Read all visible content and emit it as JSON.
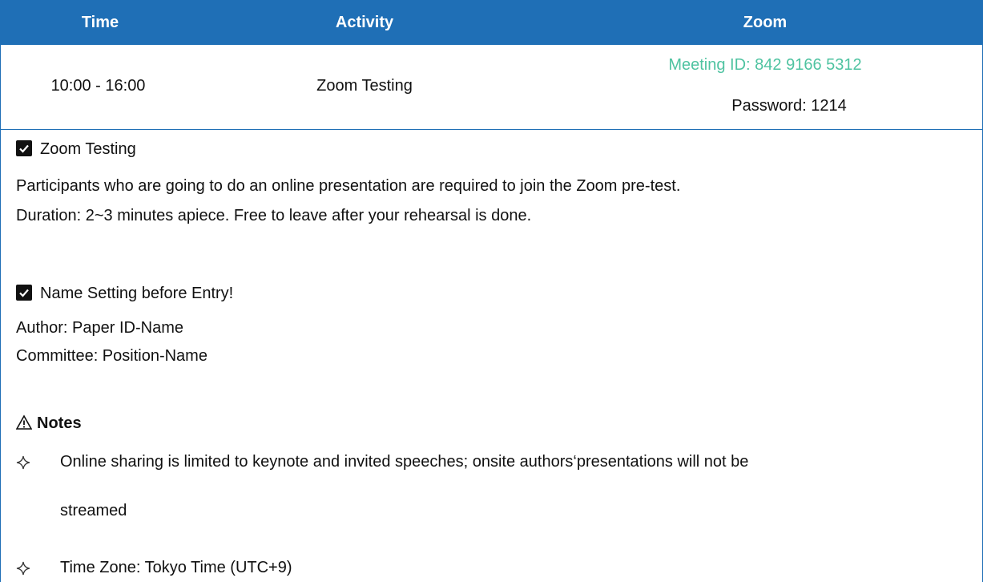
{
  "table": {
    "headers": [
      "Time",
      "Activity",
      "Zoom"
    ],
    "row": {
      "time": "10:00 - 16:00",
      "activity": "Zoom Testing",
      "meeting_id": "Meeting ID: 842 9166 5312",
      "password": "Password: 1214"
    }
  },
  "zoom_testing": {
    "title": "Zoom Testing",
    "line1": "Participants who are going to do an online presentation are required to join the Zoom pre-test.",
    "line2": "Duration: 2~3 minutes apiece. Free to leave after your rehearsal is done."
  },
  "name_setting": {
    "title": "Name Setting before Entry!",
    "author": "Author: Paper ID-Name",
    "committee": "Committee: Position-Name"
  },
  "notes": {
    "title": "Notes",
    "items": [
      "Online sharing is limited to keynote and invited speeches; onsite authors‘presentations will not be",
      "streamed",
      "Time Zone: Tokyo Time (UTC+9)"
    ]
  },
  "colors": {
    "header_bg": "#1f6fb6",
    "meeting_id": "#4fc3a1"
  },
  "icons": {
    "check": "check-box-icon",
    "warning": "warning-triangle-icon",
    "bullet": "four-point-star-icon"
  }
}
